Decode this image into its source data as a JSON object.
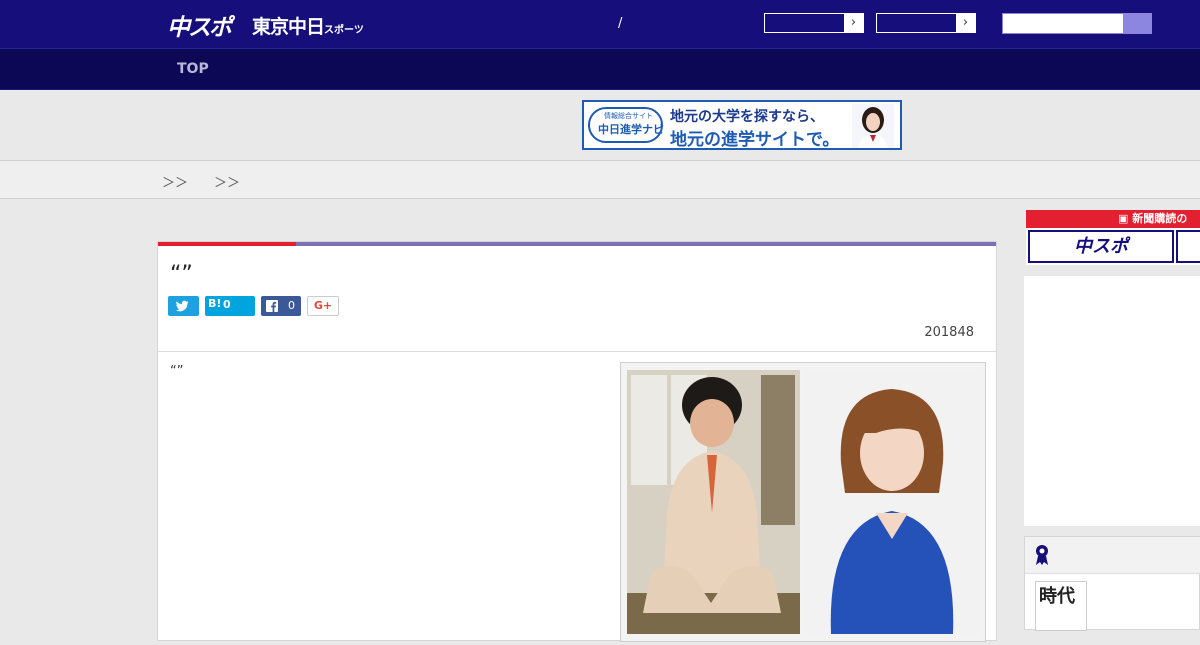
{
  "header": {
    "logo_primary": "中スポ",
    "logo_secondary": "東京中日",
    "logo_secondary_small": "スポーツ",
    "separator": "/",
    "select_1": {
      "value": ""
    },
    "select_2": {
      "value": ""
    },
    "search": {
      "placeholder": ""
    }
  },
  "nav": {
    "items": [
      "TOP"
    ]
  },
  "ad_banner": {
    "badge_top": "情報総合サイト",
    "badge_main": "中日進学ナビ",
    "line1": "地元の大学を探すなら、",
    "line2": "地元の進学サイトで。"
  },
  "breadcrumb": {
    "text": "＞＞　　＞＞"
  },
  "article": {
    "title": "“”",
    "share": {
      "hatena_label": "B!",
      "hatena_count": "0",
      "facebook_count": "0",
      "gplus_label": "G+"
    },
    "date": "201848",
    "body": "“”"
  },
  "sidebar": {
    "subscribe_text": "新聞購読の",
    "ad_logo": "中スポ",
    "ranking_thumb_text": "時代"
  },
  "colors": {
    "header_bg": "#160f7b",
    "nav_bg": "#0d0856",
    "accent_red": "#e3202f",
    "accent_purple": "#7b6fb8"
  }
}
